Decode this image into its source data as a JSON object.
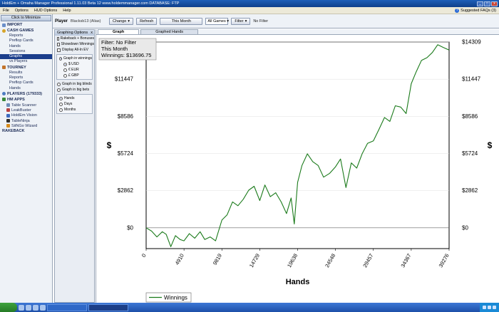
{
  "window": {
    "title": "HoldEm + Omaha Manager Professional 1.11.03 Beta 12          www.holdemmanager.com          DATABASE: FTP",
    "min": "_",
    "max": "□",
    "close": "x"
  },
  "menu": {
    "items": [
      "File",
      "Options",
      "HUD Options",
      "Help"
    ],
    "faq_label": "Suggested FAQs (3)"
  },
  "sidebar": {
    "minimize_label": "Click to Minimize",
    "import_label": "IMPORT",
    "cash_label": "CASH GAMES",
    "cash_items": [
      "Reports",
      "Preflop Cards",
      "Hands",
      "Sessions",
      "Graphs",
      "vs Players"
    ],
    "tourney_label": "TOURNEY",
    "tourney_items": [
      "Results",
      "Reports",
      "Preflop Cards",
      "Hands"
    ],
    "players_label": "PLAYERS (179333)",
    "apps_label": "HM APPS",
    "apps_items": [
      "Table Scanner",
      "LeakBuster",
      "HoldEm Vision",
      "TableNinja",
      "SitNGo Wizard"
    ],
    "rakeback_label": "RAKEBACK"
  },
  "player_bar": {
    "label": "Player",
    "name": "Blacksb13 (Alias)",
    "change_label": "Change",
    "refresh_label": "Refresh",
    "month_label": "This Month",
    "games_value": "All Games",
    "filter_label": "Filter",
    "no_filter_text": "No Filter"
  },
  "options": {
    "title": "Graphing Options",
    "close": "x",
    "checks": [
      "Rakeback + Bonuses",
      "Showdown Winnings",
      "Display All-In EV"
    ],
    "graph_winnings": "Graph in winnings",
    "currencies": [
      "$ USD",
      "€ EUR",
      "£ GBP"
    ],
    "graph_bb": "Graph in big blinds",
    "graph_bets": "Graph in big bets",
    "axis_modes": [
      "Hands",
      "Days",
      "Months"
    ]
  },
  "tabs": [
    "Graph",
    "Graphed Hands"
  ],
  "chart_data": {
    "type": "line",
    "xlabel": "Hands",
    "ylabel": "$",
    "x_ticks": [
      "0",
      "4910",
      "9819",
      "14729",
      "19638",
      "24548",
      "29457",
      "34367",
      "39276"
    ],
    "y_ticks": [
      "$0",
      "$2862",
      "$5724",
      "$8586",
      "$11447",
      "$14309"
    ],
    "xlim": [
      0,
      39276
    ],
    "ylim": [
      -1600,
      14309
    ],
    "info_lines": [
      "Filter: No Filter",
      "This Month",
      "Winnings: $13696.75"
    ],
    "series": [
      {
        "name": "Winnings",
        "color": "#1a7a1a",
        "x": [
          0,
          700,
          1400,
          2100,
          2600,
          3200,
          3800,
          4400,
          4910,
          5600,
          6300,
          7000,
          7600,
          8300,
          9000,
          9819,
          10500,
          11200,
          11900,
          12600,
          13300,
          14000,
          14729,
          15400,
          16100,
          16800,
          17500,
          18200,
          18800,
          19200,
          19638,
          20200,
          20900,
          21600,
          22300,
          23000,
          23800,
          24548,
          25200,
          25900,
          26600,
          27300,
          28000,
          28700,
          29457,
          30200,
          30900,
          31600,
          32300,
          33000,
          33700,
          34367,
          35000,
          35700,
          36400,
          37100,
          37800,
          38500,
          39276
        ],
        "y": [
          0,
          -250,
          -700,
          -300,
          -500,
          -1450,
          -600,
          -900,
          -1000,
          -450,
          -800,
          -300,
          -900,
          -700,
          -1000,
          600,
          1000,
          2000,
          1700,
          2200,
          2900,
          3200,
          2100,
          3300,
          2400,
          2700,
          2000,
          1100,
          2300,
          300,
          3500,
          4800,
          5700,
          5100,
          4800,
          3900,
          4200,
          4700,
          5300,
          3100,
          5000,
          4600,
          5700,
          6500,
          6700,
          7600,
          8500,
          8200,
          9400,
          9300,
          8800,
          11100,
          12000,
          12900,
          13100,
          13500,
          14100,
          13900,
          13697
        ]
      }
    ],
    "legend": "bottom-left",
    "grid": "horizontal"
  }
}
